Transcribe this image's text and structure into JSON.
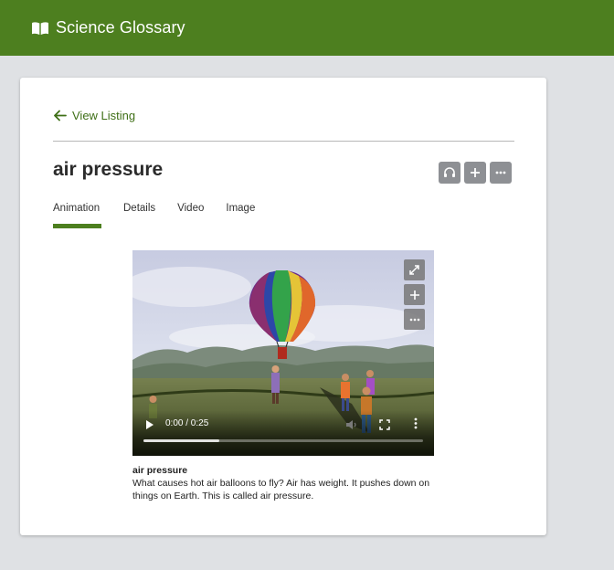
{
  "header": {
    "title": "Science Glossary",
    "icon": "book-icon"
  },
  "nav": {
    "back_label": "View Listing"
  },
  "term": {
    "title": "air pressure"
  },
  "actions": [
    "headphones-icon",
    "plus-icon",
    "more-icon"
  ],
  "tabs": [
    {
      "label": "Animation",
      "active": true
    },
    {
      "label": "Details",
      "active": false
    },
    {
      "label": "Video",
      "active": false
    },
    {
      "label": "Image",
      "active": false
    }
  ],
  "media": {
    "time": "0:00 / 0:25",
    "progress_fraction": 0.27,
    "overlay_buttons": [
      "expand-icon",
      "plus-icon",
      "more-icon"
    ]
  },
  "caption": {
    "title": "air pressure",
    "text": "What causes hot air balloons to fly? Air has weight. It pushes down on things on Earth. This is called air pressure."
  },
  "colors": {
    "brand": "#4d7f1f",
    "link": "#3e6f16",
    "button": "#8e9094"
  }
}
